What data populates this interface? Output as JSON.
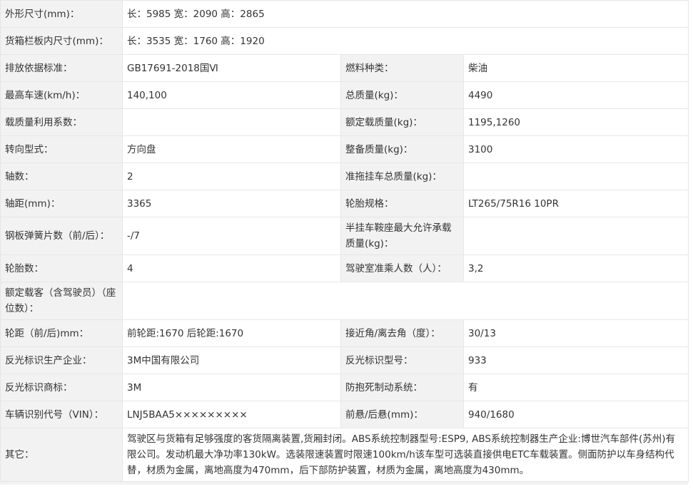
{
  "rows": [
    {
      "label": "外形尺寸(mm)：",
      "value": "长：5985 宽：2090 高：2865"
    },
    {
      "label": "货箱栏板内尺寸(mm)：",
      "value": "长：3535 宽：1760 高：1920"
    },
    {
      "label": "排放依据标准：",
      "value": "GB17691-2018国Ⅵ",
      "label2": "燃料种类：",
      "value2": "柴油"
    },
    {
      "label": "最高车速(km/h)：",
      "value": "140,100",
      "label2": "总质量(kg)：",
      "value2": "4490"
    },
    {
      "label": "载质量利用系数：",
      "value": "",
      "label2": "额定载质量(kg)：",
      "value2": "1195,1260"
    },
    {
      "label": "转向型式：",
      "value": "方向盘",
      "label2": "整备质量(kg)：",
      "value2": "3100"
    },
    {
      "label": "轴数：",
      "value": "2",
      "label2": "准拖挂车总质量(kg)：",
      "value2": ""
    },
    {
      "label": "轴距(mm)：",
      "value": "3365",
      "label2": "轮胎规格：",
      "value2": "LT265/75R16 10PR"
    },
    {
      "label": "钢板弹簧片数（前/后）：",
      "value": "-/7",
      "label2": "半挂车鞍座最大允许承载质量(kg)：",
      "value2": ""
    },
    {
      "label": "轮胎数：",
      "value": "4",
      "label2": "驾驶室准乘人数（人）：",
      "value2": "3,2"
    },
    {
      "label": "额定载客（含驾驶员）（座位数）：",
      "value": ""
    },
    {
      "label": "轮距（前/后)mm：",
      "value": "前轮距:1670 后轮距:1670",
      "label2": "接近角/离去角（度）：",
      "value2": "30/13"
    },
    {
      "label": "反光标识生产企业：",
      "value": "3M中国有限公司",
      "label2": "反光标识型号：",
      "value2": "933"
    },
    {
      "label": "反光标识商标：",
      "value": "3M",
      "label2": "防抱死制动系统：",
      "value2": "有"
    },
    {
      "label": "车辆识别代号（VIN）：",
      "value": "LNJ5BAA5×××××××××",
      "label2": "前悬/后悬(mm)：",
      "value2": "940/1680"
    },
    {
      "label": "其它：",
      "value": "驾驶区与货箱有足够强度的客货隔离装置,货厢封闭。ABS系统控制器型号:ESP9, ABS系统控制器生产企业:博世汽车部件(苏州)有限公司。发动机最大净功率130kW。选装限速装置时限速100km/h该车型可选装直接供电ETC车载装置。侧面防护以车身结构代替，材质为金属，离地高度为470mm，后下部防护装置，材质为金属，离地高度为430mm。"
    }
  ]
}
